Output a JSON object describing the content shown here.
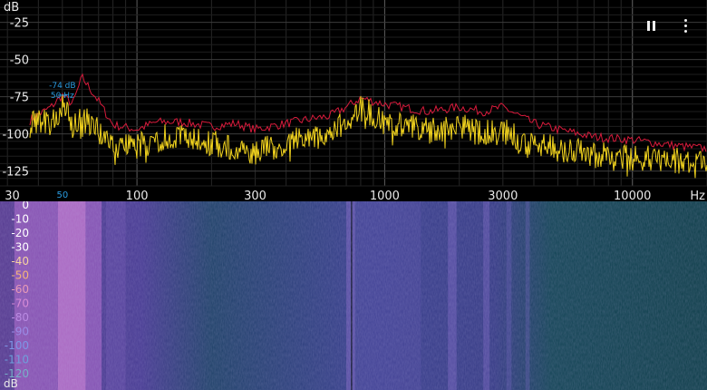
{
  "spectrum": {
    "y_unit": "dB",
    "y_ticks": [
      {
        "label": "-25",
        "value": -25
      },
      {
        "label": "-50",
        "value": -50
      },
      {
        "label": "-75",
        "value": -75
      },
      {
        "label": "-100",
        "value": -100
      },
      {
        "label": "-125",
        "value": -125
      }
    ],
    "y_range": [
      -10,
      -135
    ],
    "x_unit": "Hz",
    "x_range": [
      28,
      20000
    ],
    "x_ticks": [
      {
        "label": "30",
        "value": 30
      },
      {
        "label": "100",
        "value": 100
      },
      {
        "label": "300",
        "value": 300
      },
      {
        "label": "1000",
        "value": 1000
      },
      {
        "label": "3000",
        "value": 3000
      },
      {
        "label": "10000",
        "value": 10000
      }
    ],
    "x_marker": {
      "label": "50",
      "value": 50
    },
    "peak": {
      "db_label": "-74 dB",
      "hz_label": "50 Hz",
      "db": -74,
      "hz": 50
    },
    "colors": {
      "live": "#f0d21e",
      "peak_hold": "#d81b3c",
      "marker": "#2a9be0",
      "grid": "#3a3a3a"
    }
  },
  "chart_data": {
    "type": "line",
    "xscale": "log",
    "xlabel": "Hz",
    "ylabel": "dB",
    "xlim": [
      28,
      20000
    ],
    "ylim": [
      -135,
      -10
    ],
    "series": [
      {
        "x": [
          30,
          35,
          40,
          45,
          50,
          55,
          60,
          70,
          80,
          100,
          120,
          150,
          200,
          250,
          300,
          400,
          500,
          600,
          700,
          800,
          1000,
          1500,
          2000,
          2500,
          3000,
          4000,
          5000,
          7000,
          10000,
          15000,
          20000
        ],
        "values": [
          -100,
          -94,
          -87,
          -82,
          -74,
          -80,
          -62,
          -78,
          -94,
          -97,
          -92,
          -92,
          -95,
          -93,
          -97,
          -93,
          -90,
          -88,
          -82,
          -76,
          -80,
          -85,
          -82,
          -85,
          -82,
          -93,
          -97,
          -102,
          -104,
          -108,
          -110
        ]
      },
      {
        "x": [
          30,
          35,
          40,
          45,
          50,
          55,
          60,
          70,
          80,
          100,
          120,
          150,
          200,
          250,
          300,
          400,
          500,
          600,
          700,
          800,
          1000,
          1500,
          2000,
          2500,
          3000,
          4000,
          5000,
          7000,
          10000,
          15000,
          20000
        ],
        "values": [
          -102,
          -96,
          -90,
          -92,
          -80,
          -96,
          -88,
          -98,
          -110,
          -108,
          -104,
          -100,
          -106,
          -110,
          -112,
          -106,
          -102,
          -100,
          -92,
          -82,
          -92,
          -98,
          -95,
          -100,
          -98,
          -108,
          -110,
          -114,
          -116,
          -118,
          -120
        ]
      }
    ]
  },
  "spectrogram": {
    "db_unit": "dB",
    "db_ticks": [
      {
        "label": "0",
        "color": "#ffffff"
      },
      {
        "label": "-10",
        "color": "#ffffff"
      },
      {
        "label": "-20",
        "color": "#ffffff"
      },
      {
        "label": "-30",
        "color": "#ffffff"
      },
      {
        "label": "-40",
        "color": "#f6d2a0"
      },
      {
        "label": "-50",
        "color": "#f4b57a"
      },
      {
        "label": "-60",
        "color": "#e79ab6"
      },
      {
        "label": "-70",
        "color": "#d58ad6"
      },
      {
        "label": "-80",
        "color": "#b98ae2"
      },
      {
        "label": "-90",
        "color": "#9a8ce6"
      },
      {
        "label": "-100",
        "color": "#7d95e6"
      },
      {
        "label": "-110",
        "color": "#6f9fdc"
      },
      {
        "label": "-120",
        "color": "#77b0c8"
      }
    ],
    "colors": {
      "low": "#153c4a",
      "mid": "#4a4aa0",
      "high": "#c678d6"
    }
  },
  "toolbar": {
    "pause_icon": "pause-icon",
    "more_icon": "more-vertical-icon"
  }
}
